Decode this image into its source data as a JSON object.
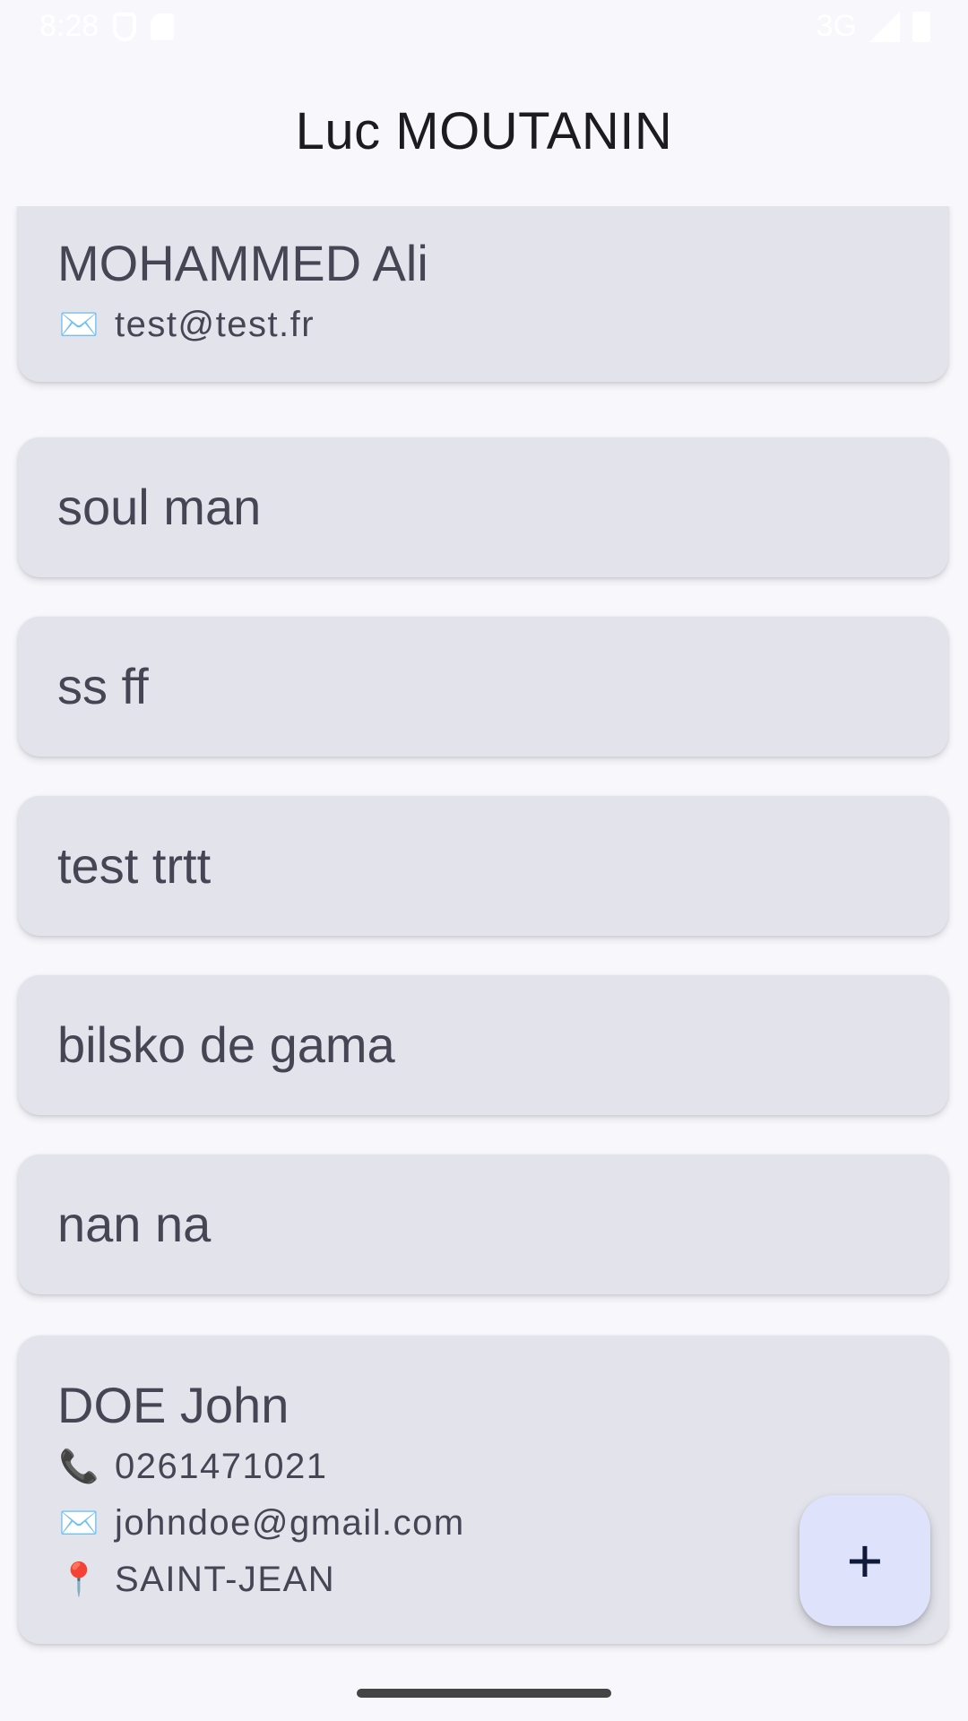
{
  "status_bar": {
    "time": "8:28",
    "network": "3G"
  },
  "app_bar": {
    "title": "Luc MOUTANIN"
  },
  "contacts": [
    {
      "name": "MOHAMMED Ali",
      "email": "test@test.fr"
    },
    {
      "name": "soul man"
    },
    {
      "name": "ss ff"
    },
    {
      "name": "test trtt"
    },
    {
      "name": "bilsko de gama"
    },
    {
      "name": "nan na"
    },
    {
      "name": "DOE John",
      "phone": "0261471021",
      "email": "johndoe@gmail.com",
      "city": "SAINT-JEAN"
    }
  ],
  "icons": {
    "email": "✉️",
    "phone": "📞",
    "location": "📍"
  },
  "fab": {
    "label": "+"
  }
}
